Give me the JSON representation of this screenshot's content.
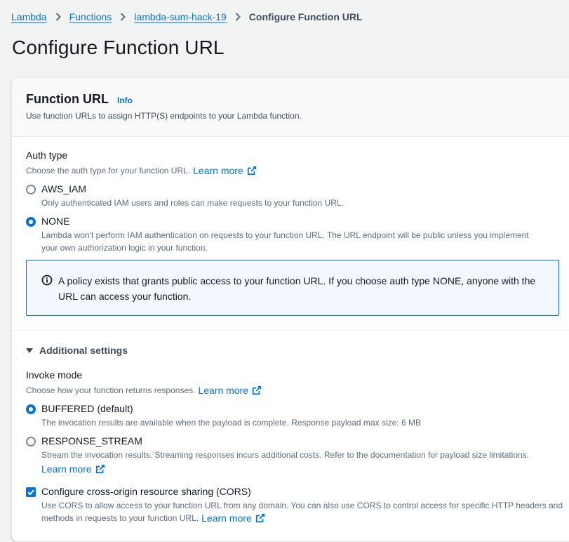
{
  "breadcrumb": {
    "items": [
      "Lambda",
      "Functions",
      "lambda-sum-hack-19"
    ],
    "current": "Configure Function URL"
  },
  "page_title": "Configure Function URL",
  "panel": {
    "title": "Function URL",
    "info_link": "Info",
    "description": "Use function URLs to assign HTTP(S) endpoints to your Lambda function."
  },
  "auth_type": {
    "label": "Auth type",
    "description": "Choose the auth type for your function URL.",
    "learn_more": "Learn more",
    "options": [
      {
        "label": "AWS_IAM",
        "description": "Only authenticated IAM users and roles can make requests to your function URL.",
        "selected": false
      },
      {
        "label": "NONE",
        "description_line1": "Lambda won't perform IAM authentication on requests to your function URL. The URL endpoint will be public unless you implement",
        "description_line2": "your own authorization logic in your function.",
        "selected": true
      }
    ]
  },
  "alert": {
    "icon": "info-circle-icon",
    "text": "A policy exists that grants public access to your function URL. If you choose auth type NONE, anyone with the URL can access your function."
  },
  "additional_settings": {
    "label": "Additional settings",
    "expanded": true,
    "invoke_mode": {
      "label": "Invoke mode",
      "description": "Choose how your function returns responses.",
      "learn_more": "Learn more",
      "options": [
        {
          "label": "BUFFERED (default)",
          "description": "The invocation results are available when the payload is complete. Response payload max size: 6 MB",
          "selected": true
        },
        {
          "label": "RESPONSE_STREAM",
          "description": "Stream the invocation results. Streaming responses incurs additional costs. Refer to the documentation for payload size limitations.",
          "learn_more": "Learn more",
          "selected": false
        }
      ]
    },
    "cors": {
      "label": "Configure cross-origin resource sharing (CORS)",
      "checked": true,
      "description_line1": "Use CORS to allow access to your function URL from any domain. You can also use CORS to control access for specific HTTP headers and",
      "description_line2": "methods in requests to your function URL.",
      "learn_more": "Learn more"
    }
  },
  "colors": {
    "link": "#0972d3",
    "background": "#f2f3f3",
    "alert_background": "#f2f8fd",
    "alert_border": "#006ce0"
  }
}
